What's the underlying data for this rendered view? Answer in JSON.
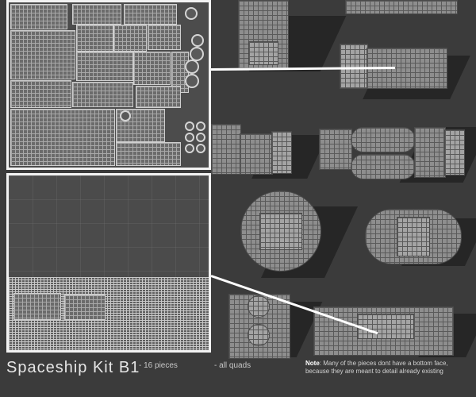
{
  "title": "Spaceship Kit B1",
  "bullets": [
    "- 16 pieces",
    "- all quads"
  ],
  "note": {
    "label": "Note",
    "text": ": Many of the pieces dont have a bottom face, because they are meant to detail already existing"
  },
  "panels": {
    "uv_top": "uv-layout-top",
    "uv_bottom": "uv-layout-bottom"
  }
}
